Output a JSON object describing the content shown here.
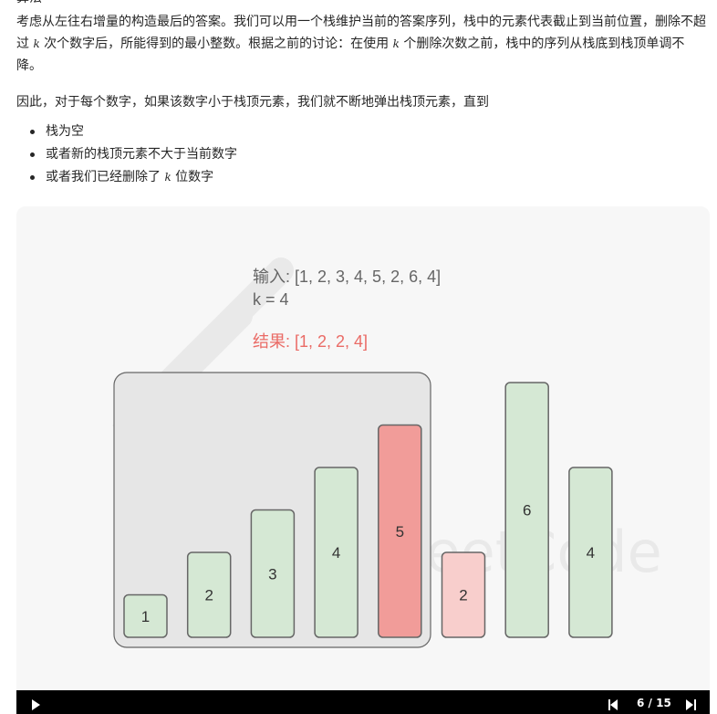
{
  "article": {
    "top_cut": "算法",
    "p1_a": "考虑从左往右增量的构造最后的答案。我们可以用一个栈维护当前的答案序列，栈中的元素代表截止到当前位置，删除不超过 ",
    "p1_k": "k",
    "p1_b": " 次个数字后，所能得到的最小整数。根据之前的讨论：在使用 ",
    "p1_k2": "k",
    "p1_c": " 个删除次数之前，栈中的序列从栈底到栈顶单调不降。",
    "p2": "因此，对于每个数字，如果该数字小于栈顶元素，我们就不断地弹出栈顶元素，直到",
    "bullets": [
      {
        "a": "栈为空",
        "k": "",
        "b": ""
      },
      {
        "a": "或者新的栈顶元素不大于当前数字",
        "k": "",
        "b": ""
      },
      {
        "a": "或者我们已经删除了 ",
        "k": "k",
        "b": " 位数字"
      }
    ]
  },
  "animation": {
    "input_label": "输入: [1, 2, 3, 4, 5, 2, 6, 4]",
    "k_label": "k = 4",
    "result_label": "结果: [1, 2, 2, 4]",
    "watermark": "LeetCode",
    "bars": [
      {
        "value": 1,
        "label": "1",
        "state": "stack"
      },
      {
        "value": 2,
        "label": "2",
        "state": "stack"
      },
      {
        "value": 3,
        "label": "3",
        "state": "stack"
      },
      {
        "value": 4,
        "label": "4",
        "state": "stack"
      },
      {
        "value": 5,
        "label": "5",
        "state": "popping"
      },
      {
        "value": 2,
        "label": "2",
        "state": "current"
      },
      {
        "value": 6,
        "label": "6",
        "state": "pending"
      },
      {
        "value": 4,
        "label": "4",
        "state": "pending"
      }
    ],
    "colors": {
      "normal_fill": "#d5e8d4",
      "popping_fill": "#f19c99",
      "current_fill": "#f8cecc",
      "bar_stroke": "#666666",
      "stack_box_fill": "#e6e6e6",
      "result_color": "#ea6b66",
      "input_color": "#666666"
    }
  },
  "player": {
    "page": "6 / 15"
  }
}
